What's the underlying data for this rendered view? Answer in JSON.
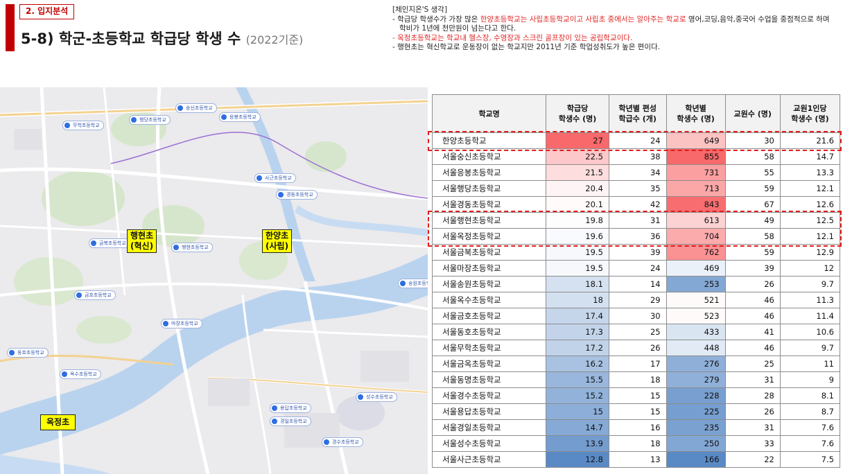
{
  "header": {
    "section_tag": "2. 입지분석",
    "title": "5-8) 학군-초등학교 학급당 학생 수",
    "subtitle": "(2022기준)"
  },
  "notes": {
    "heading": "[체인지온'S 생각]",
    "items": [
      {
        "parts": [
          {
            "text": "- 학급당 학생수가 가장 많은 ",
            "red": false
          },
          {
            "text": "한양초등학교는 사립초등학교이고 사립초 중에서는 알아주는 학교로",
            "red": true
          },
          {
            "text": " 영어,코딩,음악,중국어 수업을 중점적으로 하며 학비가 1년에 천만원이 넘는다고 한다.",
            "red": false
          }
        ]
      },
      {
        "parts": [
          {
            "text": "- 옥정초등학교는 학교내 헬스장, 수영장과 스크린 골프장이 있는 공립학교이다.",
            "red": true
          }
        ]
      },
      {
        "parts": [
          {
            "text": "- 행현초는 혁신학교로 운동장이 없는 학교지만 2011년 기준 학업성취도가 높은 편이다.",
            "red": false
          }
        ]
      }
    ]
  },
  "map": {
    "labels": [
      {
        "key": "haenghyeon",
        "line1": "행현초",
        "line2": "(혁신)"
      },
      {
        "key": "hanyang",
        "line1": "한양초",
        "line2": "(사립)"
      },
      {
        "key": "okjeong",
        "line1": "옥정초",
        "line2": ""
      }
    ],
    "pins": [
      "숭신초등학교",
      "행당초등학교",
      "무학초등학교",
      "응봉초등학교",
      "사근초등학교",
      "금북초등학교",
      "행현초등학교",
      "금호초등학교",
      "동호초등학교",
      "옥수초등학교",
      "경동초등학교",
      "경수초등학교",
      "경일초등학교",
      "성수초등학교",
      "송원초등학교",
      "용답초등학교",
      "마장초등학교"
    ]
  },
  "table": {
    "headers": [
      {
        "line1": "학교명",
        "line2": ""
      },
      {
        "line1": "학급당",
        "line2": "학생수 (명)"
      },
      {
        "line1": "학년별 편성",
        "line2": "학급수 (개)"
      },
      {
        "line1": "학년별",
        "line2": "학생수 (명)"
      },
      {
        "line1": "교원수 (명)",
        "line2": ""
      },
      {
        "line1": "교원1인당",
        "line2": "학생수 (명)"
      }
    ],
    "rows": [
      {
        "name": "한양초등학교",
        "per_class": "27",
        "classes": "24",
        "students": "649",
        "teachers": "30",
        "per_teacher": "21.6"
      },
      {
        "name": "서울숭신초등학교",
        "per_class": "22.5",
        "classes": "38",
        "students": "855",
        "teachers": "58",
        "per_teacher": "14.7"
      },
      {
        "name": "서울응봉초등학교",
        "per_class": "21.5",
        "classes": "34",
        "students": "731",
        "teachers": "55",
        "per_teacher": "13.3"
      },
      {
        "name": "서울행당초등학교",
        "per_class": "20.4",
        "classes": "35",
        "students": "713",
        "teachers": "59",
        "per_teacher": "12.1"
      },
      {
        "name": "서울경동초등학교",
        "per_class": "20.1",
        "classes": "42",
        "students": "843",
        "teachers": "67",
        "per_teacher": "12.6"
      },
      {
        "name": "서울행현초등학교",
        "per_class": "19.8",
        "classes": "31",
        "students": "613",
        "teachers": "49",
        "per_teacher": "12.5"
      },
      {
        "name": "서울옥정초등학교",
        "per_class": "19.6",
        "classes": "36",
        "students": "704",
        "teachers": "58",
        "per_teacher": "12.1"
      },
      {
        "name": "서울금북초등학교",
        "per_class": "19.5",
        "classes": "39",
        "students": "762",
        "teachers": "59",
        "per_teacher": "12.9"
      },
      {
        "name": "서울마장초등학교",
        "per_class": "19.5",
        "classes": "24",
        "students": "469",
        "teachers": "39",
        "per_teacher": "12"
      },
      {
        "name": "서울송원초등학교",
        "per_class": "18.1",
        "classes": "14",
        "students": "253",
        "teachers": "26",
        "per_teacher": "9.7"
      },
      {
        "name": "서울옥수초등학교",
        "per_class": "18",
        "classes": "29",
        "students": "521",
        "teachers": "46",
        "per_teacher": "11.3"
      },
      {
        "name": "서울금호초등학교",
        "per_class": "17.4",
        "classes": "30",
        "students": "523",
        "teachers": "46",
        "per_teacher": "11.4"
      },
      {
        "name": "서울동호초등학교",
        "per_class": "17.3",
        "classes": "25",
        "students": "433",
        "teachers": "41",
        "per_teacher": "10.6"
      },
      {
        "name": "서울무학초등학교",
        "per_class": "17.2",
        "classes": "26",
        "students": "448",
        "teachers": "46",
        "per_teacher": "9.7"
      },
      {
        "name": "서울금옥초등학교",
        "per_class": "16.2",
        "classes": "17",
        "students": "276",
        "teachers": "25",
        "per_teacher": "11"
      },
      {
        "name": "서울동명초등학교",
        "per_class": "15.5",
        "classes": "18",
        "students": "279",
        "teachers": "31",
        "per_teacher": "9"
      },
      {
        "name": "서울경수초등학교",
        "per_class": "15.2",
        "classes": "15",
        "students": "228",
        "teachers": "28",
        "per_teacher": "8.1"
      },
      {
        "name": "서울용답초등학교",
        "per_class": "15",
        "classes": "15",
        "students": "225",
        "teachers": "26",
        "per_teacher": "8.7"
      },
      {
        "name": "서울경일초등학교",
        "per_class": "14.7",
        "classes": "16",
        "students": "235",
        "teachers": "31",
        "per_teacher": "7.6"
      },
      {
        "name": "서울성수초등학교",
        "per_class": "13.9",
        "classes": "18",
        "students": "250",
        "teachers": "33",
        "per_teacher": "7.6"
      },
      {
        "name": "서울사근초등학교",
        "per_class": "12.8",
        "classes": "13",
        "students": "166",
        "teachers": "22",
        "per_teacher": "7.5"
      }
    ],
    "highlight_rows": [
      [
        0,
        0
      ],
      [
        5,
        6
      ]
    ],
    "scale_colors": {
      "high": "#f8696b",
      "mid": "#ffffff",
      "low": "#5a8ac6"
    }
  }
}
